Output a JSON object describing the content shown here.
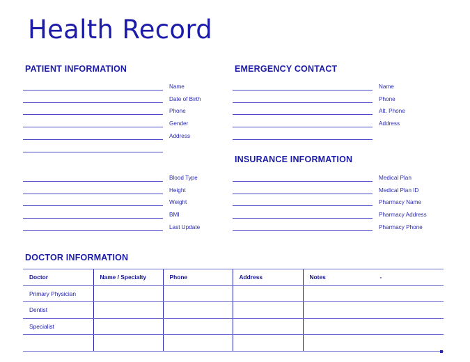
{
  "document": {
    "title": "Health Record",
    "accent_color": "#1c1ca8",
    "line_color": "#4a4ac8"
  },
  "patient_information": {
    "heading": "PATIENT INFORMATION",
    "fields": [
      {
        "label": "Name",
        "value": ""
      },
      {
        "label": "Date of Birth",
        "value": ""
      },
      {
        "label": "Phone",
        "value": ""
      },
      {
        "label": "Gender",
        "value": ""
      },
      {
        "label": "Address",
        "value": ""
      },
      {
        "label": "",
        "value": ""
      }
    ],
    "vitals": [
      {
        "label": "Blood Type",
        "value": ""
      },
      {
        "label": "Height",
        "value": ""
      },
      {
        "label": "Weight",
        "value": ""
      },
      {
        "label": "BMI",
        "value": ""
      },
      {
        "label": "Last Update",
        "value": ""
      }
    ]
  },
  "emergency_contact": {
    "heading": "EMERGENCY CONTACT",
    "fields": [
      {
        "label": "Name",
        "value": ""
      },
      {
        "label": "Phone",
        "value": ""
      },
      {
        "label": "Alt. Phone",
        "value": ""
      },
      {
        "label": "Address",
        "value": ""
      },
      {
        "label": "",
        "value": ""
      }
    ]
  },
  "insurance_information": {
    "heading": "INSURANCE INFORMATION",
    "fields": [
      {
        "label": "Medical Plan",
        "value": ""
      },
      {
        "label": "Medical Plan ID",
        "value": ""
      },
      {
        "label": "Pharmacy Name",
        "value": ""
      },
      {
        "label": "Pharmacy Address",
        "value": ""
      },
      {
        "label": "Pharmacy Phone",
        "value": ""
      }
    ]
  },
  "doctor_information": {
    "heading": "DOCTOR INFORMATION",
    "columns": [
      "Doctor",
      "Name / Specialty",
      "Phone",
      "Address",
      "Notes"
    ],
    "notes_header_suffix": "-",
    "rows": [
      [
        "Primary Physician",
        "",
        "",
        "",
        ""
      ],
      [
        "Dentist",
        "",
        "",
        "",
        ""
      ],
      [
        "Specialist",
        "",
        "",
        "",
        ""
      ],
      [
        "",
        "",
        "",
        "",
        ""
      ]
    ]
  }
}
